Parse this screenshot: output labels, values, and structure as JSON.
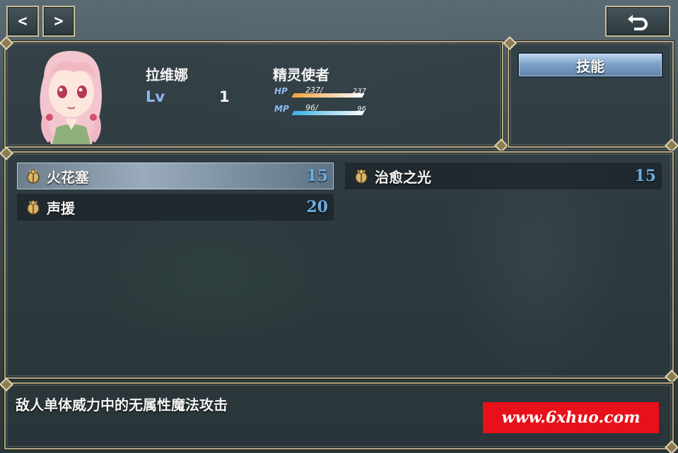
{
  "nav": {
    "prev_label": "<",
    "next_label": ">"
  },
  "actor": {
    "name": "拉维娜",
    "class": "精灵使者",
    "level_label": "Lv",
    "level": "1",
    "hp": {
      "label": "HP",
      "current": "237/",
      "max": "237",
      "ratio": 1.0,
      "color": "#f2a23a"
    },
    "mp": {
      "label": "MP",
      "current": "96/",
      "max": "96",
      "ratio": 1.0,
      "color": "#3ab0e6"
    }
  },
  "command": {
    "skill_label": "技能"
  },
  "skills": [
    {
      "name": "火花塞",
      "cost": "15",
      "icon": "beetle-icon",
      "selected": true
    },
    {
      "name": "治愈之光",
      "cost": "15",
      "icon": "beetle-icon",
      "selected": false
    },
    {
      "name": "声援",
      "cost": "20",
      "icon": "beetle-icon",
      "selected": false
    }
  ],
  "help": {
    "text": "敌人单体威力中的无属性魔法攻击"
  },
  "watermark": {
    "text": "www.6xhuo.com"
  },
  "colors": {
    "cost": "#6cb0e6",
    "frame": "#b7a982",
    "watermark_bg": "#e8101a"
  }
}
